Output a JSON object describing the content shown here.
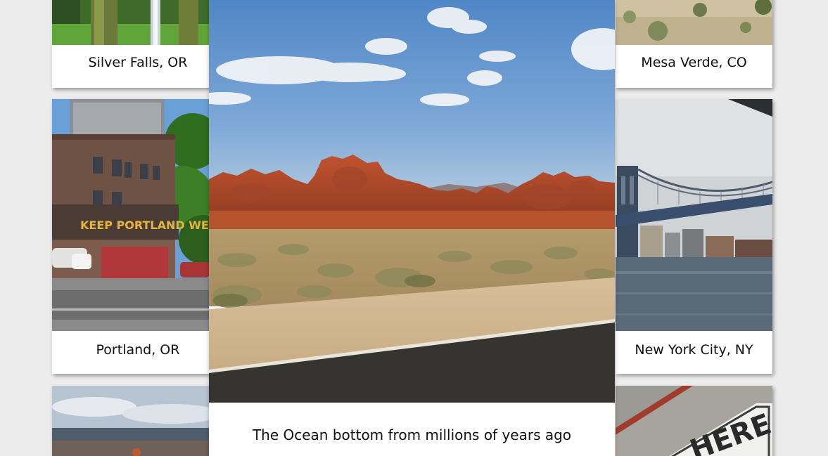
{
  "gallery": {
    "cards": [
      {
        "id": "silver-falls",
        "caption": "Silver Falls, OR"
      },
      {
        "id": "mesa-verde",
        "caption": "Mesa Verde, CO"
      },
      {
        "id": "portland",
        "caption": "Portland, OR",
        "sign_text": "KEEP PORTLAND WEIRD"
      },
      {
        "id": "new-york",
        "caption": "New York City, NY"
      },
      {
        "id": "canyon",
        "caption": ""
      },
      {
        "id": "sign-photo",
        "caption": "",
        "sign_text": "HERE"
      }
    ]
  },
  "lightbox": {
    "caption": "The Ocean bottom from millions of years ago"
  },
  "colors": {
    "background": "#ececec",
    "card": "#ffffff",
    "caption_text": "#111111"
  }
}
